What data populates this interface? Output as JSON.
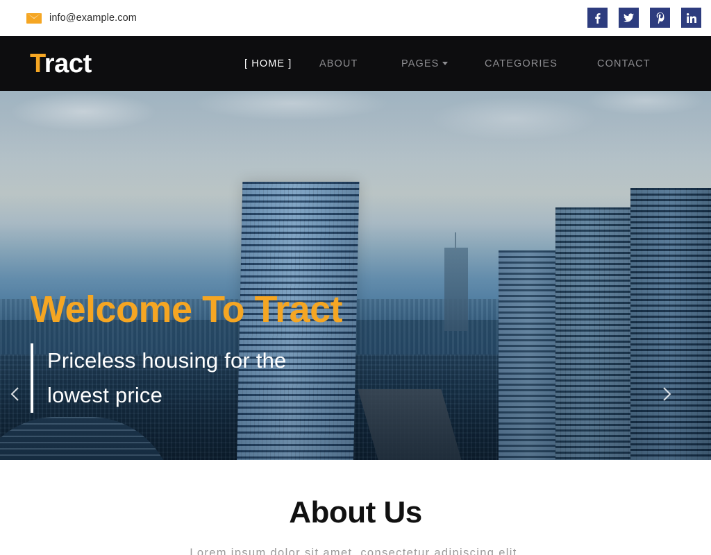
{
  "topbar": {
    "email": "info@example.com",
    "mail_icon": "envelope-icon",
    "socials": [
      {
        "name": "facebook",
        "glyph": "f",
        "color": "#2d3c7e"
      },
      {
        "name": "twitter",
        "glyph": "t",
        "color": "#2d3c7e"
      },
      {
        "name": "pinterest",
        "glyph": "P",
        "color": "#2d3c7e"
      },
      {
        "name": "linkedin",
        "glyph": "in",
        "color": "#2d3c7e"
      }
    ]
  },
  "navbar": {
    "logo_accent": "T",
    "logo_rest": "ract",
    "background": "#0d0d0f",
    "accent_color": "#f5a623",
    "items": [
      {
        "label": "[ HOME ]",
        "active": true,
        "caret": false
      },
      {
        "label": "ABOUT",
        "active": false,
        "caret": false
      },
      {
        "label": "PAGES",
        "active": false,
        "caret": true
      },
      {
        "label": "CATEGORIES",
        "active": false,
        "caret": false
      },
      {
        "label": "CONTACT",
        "active": false,
        "caret": false
      }
    ]
  },
  "hero": {
    "title": "Welcome To Tract",
    "subtitle_line1": "Priceless housing for the",
    "subtitle_line2": "lowest price",
    "title_color": "#f5a623",
    "prev_icon": "chevron-left-icon",
    "next_icon": "chevron-right-icon",
    "image_description": "Aerial photo of a modern city skyline with glass skyscrapers"
  },
  "about": {
    "title": "About Us",
    "subtitle": "Lorem ipsum dolor sit amet, consectetur adipiscing elit."
  }
}
